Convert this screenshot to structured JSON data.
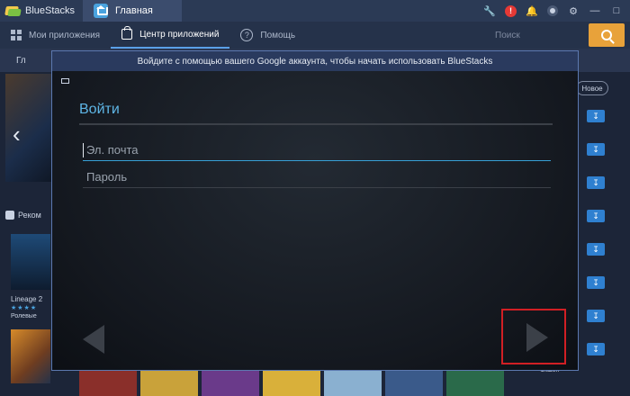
{
  "app": {
    "name": "BlueStacks"
  },
  "tabs": [
    {
      "label": "Главная"
    }
  ],
  "title_icons": [
    "wrench-icon",
    "alert-icon",
    "bell-icon",
    "record-icon",
    "settings-icon",
    "minimize-icon",
    "maximize-icon"
  ],
  "alert_badge": "!",
  "nav": {
    "my_apps": "Мои приложения",
    "app_center": "Центр приложений",
    "help": "Помощь",
    "help_glyph": "?",
    "search_placeholder": "Поиск"
  },
  "background": {
    "breadcrumb_text": "Гл",
    "recommend_label": "Реком",
    "new_label": "Новое",
    "app1": {
      "name": "Lineage 2",
      "stars": "★★★★",
      "genre": "Ролевые"
    },
    "app_side_text": "Экшен"
  },
  "modal": {
    "header": "Войдите с помощью вашего Google аккаунта, чтобы начать использовать BlueStacks",
    "title": "Войти",
    "email_placeholder": "Эл. почта",
    "password_placeholder": "Пароль"
  },
  "colors": {
    "accent": "#5eb6e6",
    "highlight": "#d11f24",
    "search_button": "#e8a23a",
    "download": "#2f80d0"
  }
}
